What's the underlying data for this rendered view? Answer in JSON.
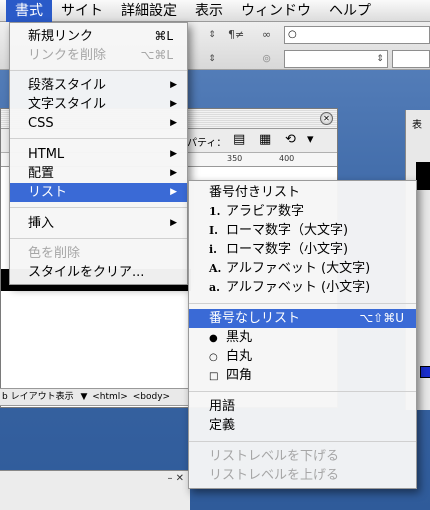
{
  "menubar": {
    "items": [
      {
        "label": "書式"
      },
      {
        "label": "サイト"
      },
      {
        "label": "詳細設定"
      },
      {
        "label": "表示"
      },
      {
        "label": "ウィンドウ"
      },
      {
        "label": "ヘルプ"
      }
    ]
  },
  "toolbar": {
    "pilcrow": "¶≠",
    "link_field_value": "○",
    "link_icon": "chain-link-icon",
    "target_icon": "target-icon"
  },
  "doc_window": {
    "properties_label": "パティ：",
    "ruler_ticks": [
      "350",
      "400"
    ],
    "status_text": "b レイアウト表示",
    "tag_html": "<html>",
    "tag_body": "<body>"
  },
  "format_menu": {
    "items": [
      {
        "label": "新規リンク",
        "shortcut": "⌘L",
        "enabled": true
      },
      {
        "label": "リンクを削除",
        "shortcut": "⌥⌘L",
        "enabled": false
      },
      {
        "label": "段落スタイル",
        "submenu": true,
        "enabled": true
      },
      {
        "label": "文字スタイル",
        "submenu": true,
        "enabled": true
      },
      {
        "label": "CSS",
        "submenu": true,
        "enabled": true
      },
      {
        "label": "HTML",
        "submenu": true,
        "enabled": true
      },
      {
        "label": "配置",
        "submenu": true,
        "enabled": true
      },
      {
        "label": "リスト",
        "submenu": true,
        "enabled": true,
        "highlighted": true
      },
      {
        "label": "挿入",
        "submenu": true,
        "enabled": true
      },
      {
        "label": "色を削除",
        "enabled": false
      },
      {
        "label": "スタイルをクリア...",
        "enabled": true
      }
    ],
    "arrow_glyph": "▶"
  },
  "list_submenu": {
    "items": [
      {
        "label": "番号付きリスト",
        "enabled": true
      },
      {
        "prefix": "1.",
        "label": "アラビア数字",
        "enabled": true
      },
      {
        "prefix": "I.",
        "label": "ローマ数字（大文字)",
        "enabled": true
      },
      {
        "prefix": "i.",
        "label": "ローマ数字（小文字)",
        "enabled": true
      },
      {
        "prefix": "A.",
        "label": "アルファベット (大文字)",
        "enabled": true
      },
      {
        "prefix": "a.",
        "label": "アルファベット (小文字)",
        "enabled": true
      },
      {
        "label": "番号なしリスト",
        "shortcut": "⌥⇧⌘U",
        "enabled": true,
        "highlighted": true
      },
      {
        "prefix": "●",
        "label": "黒丸",
        "enabled": true
      },
      {
        "prefix": "○",
        "label": "白丸",
        "enabled": true
      },
      {
        "prefix": "□",
        "label": "四角",
        "enabled": true
      },
      {
        "label": "用語",
        "enabled": true
      },
      {
        "label": "定義",
        "enabled": true
      },
      {
        "label": "リストレベルを下げる",
        "enabled": false
      },
      {
        "label": "リストレベルを上げる",
        "enabled": false
      }
    ]
  },
  "colors": {
    "highlight": "#3a6ad6",
    "menubar_active": "#2a5ac8",
    "disabled_text": "#a6a6a6"
  }
}
